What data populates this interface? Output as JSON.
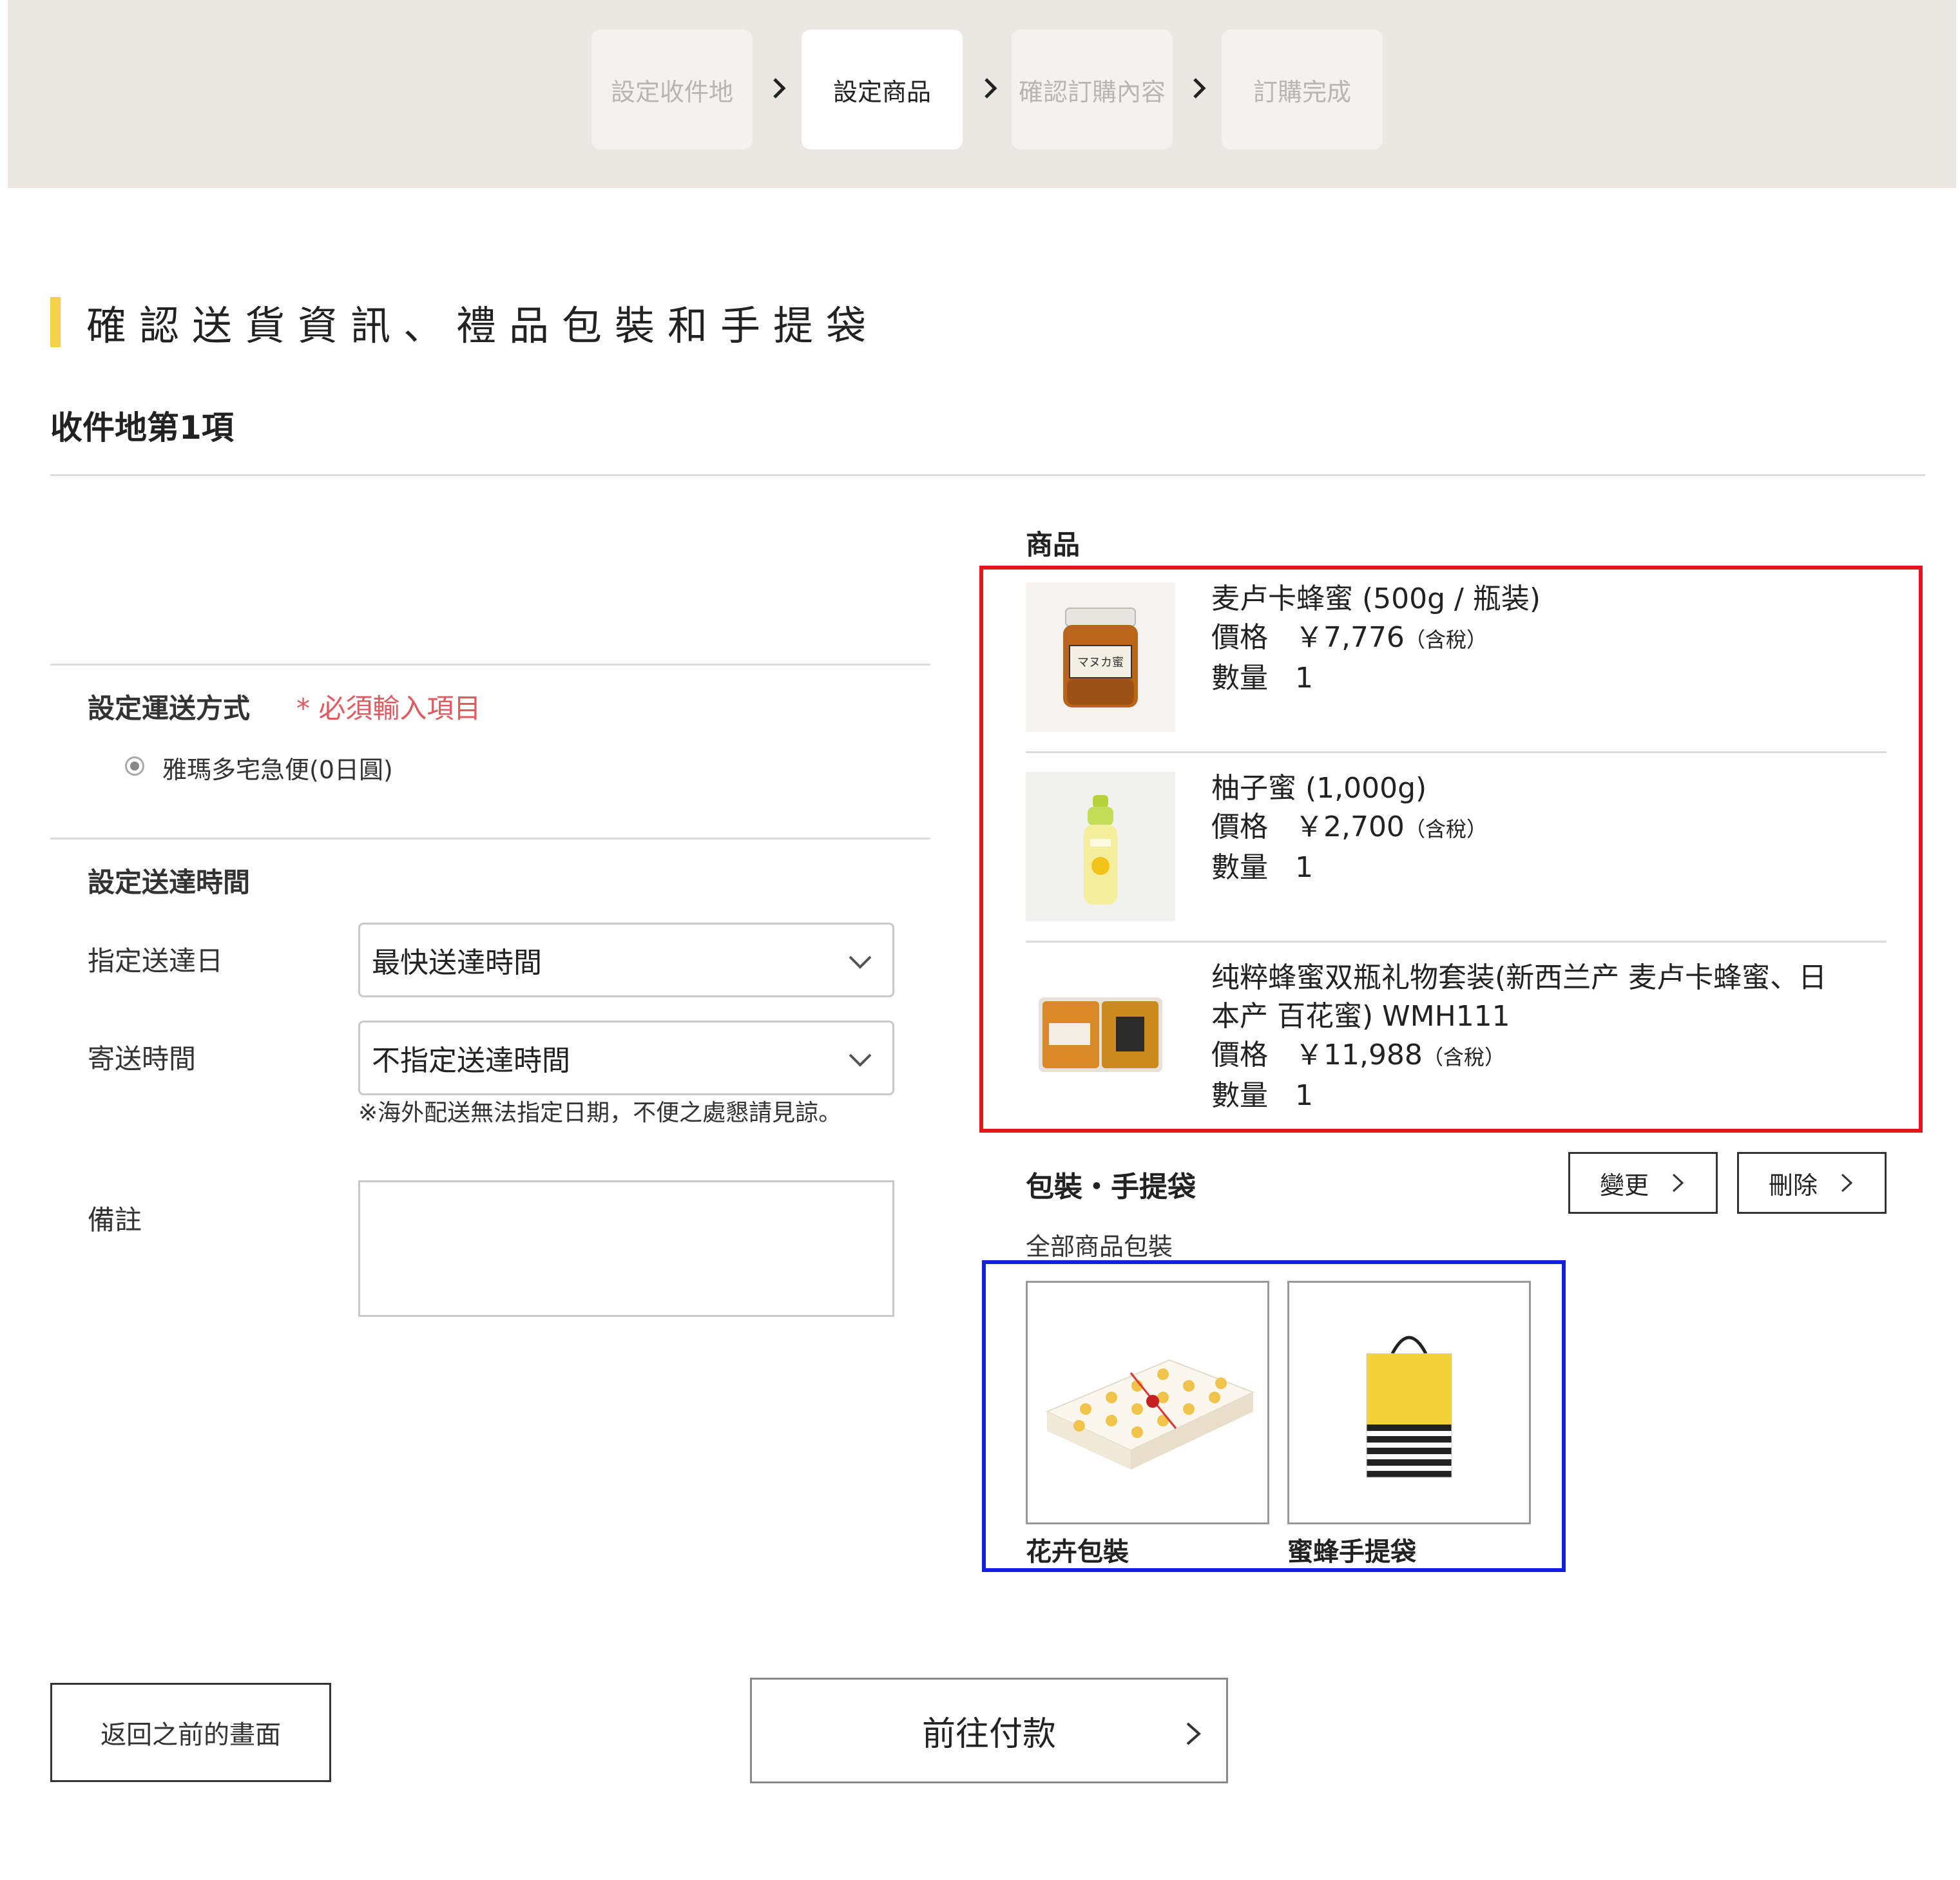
{
  "steps": [
    {
      "label": "設定收件地",
      "active": false
    },
    {
      "label": "設定商品",
      "active": true
    },
    {
      "label": "確認訂購內容",
      "active": false
    },
    {
      "label": "訂購完成",
      "active": false
    }
  ],
  "page_title": "確認送貨資訊、禮品包裝和手提袋",
  "destination_title": "收件地第1項",
  "shipping": {
    "section_label": "設定運送方式",
    "required_label": "* 必須輸入項目",
    "option_label": "雅瑪多宅急便(0日圓)"
  },
  "delivery": {
    "section_label": "設定送達時間",
    "date_label": "指定送達日",
    "date_value": "最快送達時間",
    "time_label": "寄送時間",
    "time_value": "不指定送達時間",
    "note": "※海外配送無法指定日期，不便之處懇請見諒。",
    "remarks_label": "備註",
    "remarks_value": ""
  },
  "products": {
    "title": "商品",
    "items": [
      {
        "name": "麦卢卡蜂蜜 (500g / 瓶装)",
        "price_label": "價格",
        "price": "￥7,776",
        "tax": "（含稅）",
        "qty_label": "數量",
        "qty": "1",
        "jar_label": "マヌカ蜜"
      },
      {
        "name": "柚子蜜 (1,000g)",
        "price_label": "價格",
        "price": "￥2,700",
        "tax": "（含稅）",
        "qty_label": "數量",
        "qty": "1"
      },
      {
        "name_line1": "纯粹蜂蜜双瓶礼物套装(新西兰产 麦卢卡蜂蜜、日",
        "name_line2": "本产 百花蜜) WMH111",
        "price_label": "價格",
        "price": "￥11,988",
        "tax": "（含稅）",
        "qty_label": "數量",
        "qty": "1"
      }
    ]
  },
  "wrapping": {
    "title": "包裝・手提袋",
    "change_label": "變更",
    "delete_label": "刪除",
    "subtitle": "全部商品包裝",
    "options": [
      {
        "label": "花卉包裝",
        "icon": "gift-box-image"
      },
      {
        "label": "蜜蜂手提袋",
        "icon": "shopping-bag-image"
      }
    ]
  },
  "actions": {
    "back_label": "返回之前的畫面",
    "pay_label": "前往付款"
  },
  "colors": {
    "header_bg": "#ebe7e3",
    "accent_yellow": "#f7d04a",
    "required_red": "#e15a60",
    "highlight_red": "#e8141c",
    "highlight_blue": "#1420e0"
  }
}
